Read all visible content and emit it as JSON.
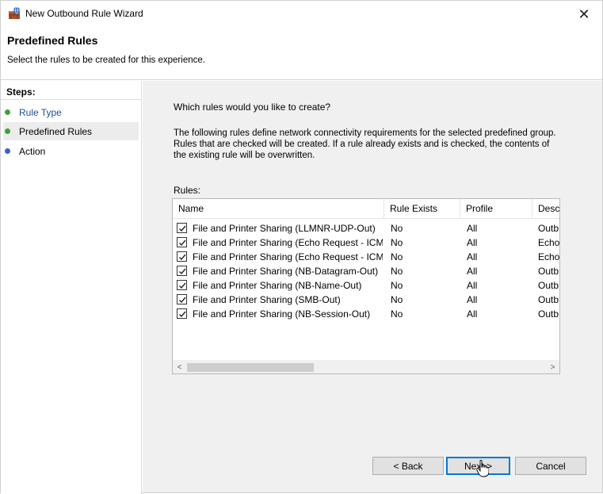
{
  "window": {
    "title": "New Outbound Rule Wizard",
    "close_glyph": "✕"
  },
  "header": {
    "title": "Predefined Rules",
    "subtitle": "Select the rules to be created for this experience."
  },
  "steps": {
    "title": "Steps:",
    "items": [
      {
        "label": "Rule Type",
        "state": "done",
        "dot_color": "#3aa33a"
      },
      {
        "label": "Predefined Rules",
        "state": "current",
        "dot_color": "#3aa33a"
      },
      {
        "label": "Action",
        "state": "todo",
        "dot_color": "#3b5fc8"
      }
    ]
  },
  "content": {
    "question": "Which rules would you like to create?",
    "description": "The following rules define network connectivity requirements for the selected predefined group. Rules that are checked will be created. If a rule already exists and is checked, the contents of the existing rule will be overwritten.",
    "rules_label": "Rules:"
  },
  "rules_table": {
    "columns": [
      "Name",
      "Rule Exists",
      "Profile",
      "Desc"
    ],
    "rows": [
      {
        "checked": true,
        "name": "File and Printer Sharing (LLMNR-UDP-Out)",
        "exists": "No",
        "profile": "All",
        "desc": "Outb"
      },
      {
        "checked": true,
        "name": "File and Printer Sharing (Echo Request - ICM...",
        "exists": "No",
        "profile": "All",
        "desc": "Echo"
      },
      {
        "checked": true,
        "name": "File and Printer Sharing (Echo Request - ICM...",
        "exists": "No",
        "profile": "All",
        "desc": "Echo"
      },
      {
        "checked": true,
        "name": "File and Printer Sharing (NB-Datagram-Out)",
        "exists": "No",
        "profile": "All",
        "desc": "Outb"
      },
      {
        "checked": true,
        "name": "File and Printer Sharing (NB-Name-Out)",
        "exists": "No",
        "profile": "All",
        "desc": "Outb"
      },
      {
        "checked": true,
        "name": "File and Printer Sharing (SMB-Out)",
        "exists": "No",
        "profile": "All",
        "desc": "Outb"
      },
      {
        "checked": true,
        "name": "File and Printer Sharing (NB-Session-Out)",
        "exists": "No",
        "profile": "All",
        "desc": "Outb"
      }
    ],
    "scroll_left_glyph": "<",
    "scroll_right_glyph": ">"
  },
  "buttons": {
    "back": "< Back",
    "next": "Next >",
    "cancel": "Cancel"
  },
  "icons": {
    "app": "firewall-icon",
    "close": "close-icon",
    "check": "checkmark-icon",
    "cursor": "hand-pointer-cursor-icon"
  }
}
